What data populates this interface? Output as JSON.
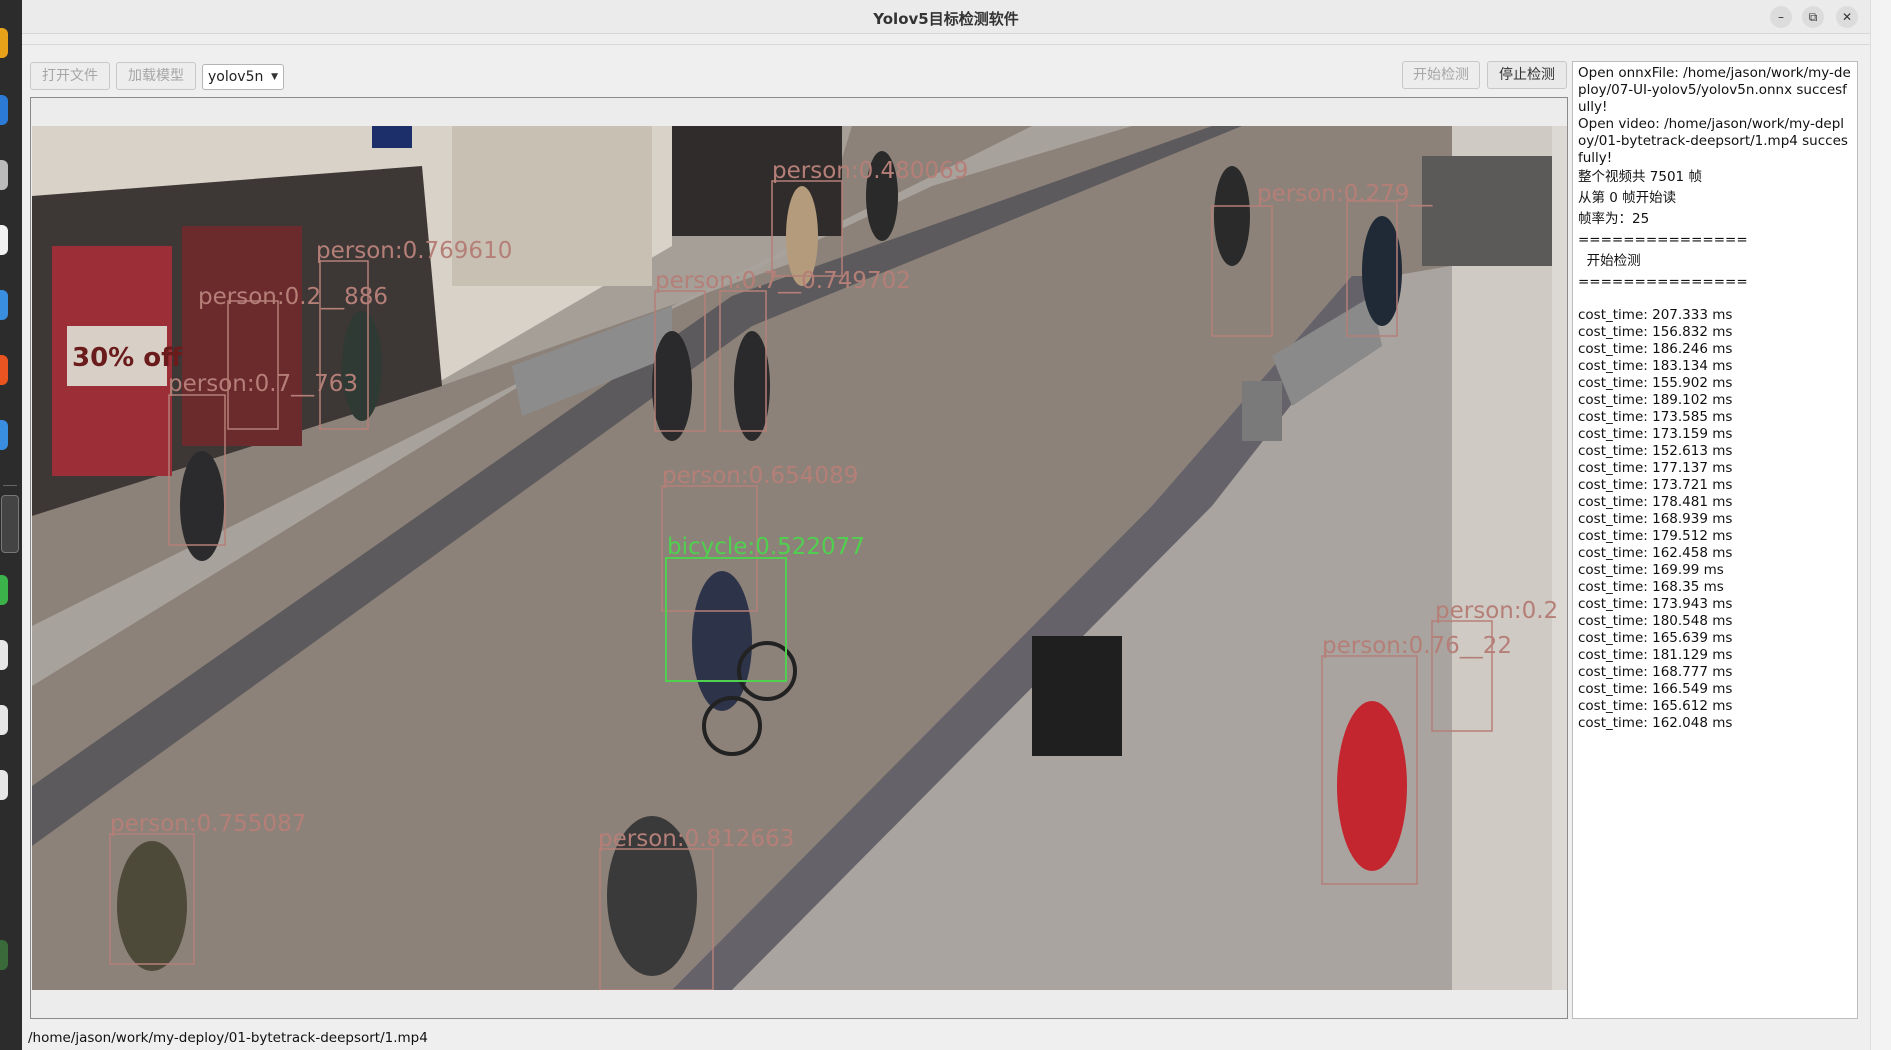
{
  "window": {
    "title": "Yolov5目标检测软件"
  },
  "window_controls": {
    "minimize": "–",
    "maximize": "⧉",
    "close": "✕"
  },
  "toolbar": {
    "open_file": "打开文件",
    "load_model": "加载模型",
    "model_select": "yolov5n",
    "start_detect": "开始检测",
    "stop_detect": "停止检测"
  },
  "detections": [
    {
      "label": "person:0.769610",
      "color": "#b57f78"
    },
    {
      "label": "person:0.2__886",
      "color": "#b57f78"
    },
    {
      "label": "person:0.7__763",
      "color": "#b57f78"
    },
    {
      "label": "person:0.7__0.749702",
      "color": "#b57f78"
    },
    {
      "label": "person:0.480069",
      "color": "#b57f78"
    },
    {
      "label": "person:0.279__",
      "color": "#b57f78"
    },
    {
      "label": "person:0.654089",
      "color": "#b57f78"
    },
    {
      "label": "bicycle:0.522077",
      "color": "#4fd14f"
    },
    {
      "label": "person:0.2",
      "color": "#b57f78"
    },
    {
      "label": "person:0.76__22",
      "color": "#b57f78"
    },
    {
      "label": "person:0.755087",
      "color": "#b57f78"
    },
    {
      "label": "person:0.812663",
      "color": "#b57f78"
    }
  ],
  "log": {
    "lines": [
      "Open onnxFile: /home/jason/work/my-deploy/07-UI-yolov5/yolov5n.onnx succesfully!",
      "Open video: /home/jason/work/my-deploy/01-bytetrack-deepsort/1.mp4 succesfully!",
      "整个视频共 7501 帧",
      "从第 0 帧开始读",
      "帧率为：25",
      "===============",
      "  开始检测",
      "==============="
    ],
    "cost_times": [
      "cost_time: 207.333 ms",
      "cost_time: 156.832 ms",
      "cost_time: 186.246 ms",
      "cost_time: 183.134 ms",
      "cost_time: 155.902 ms",
      "cost_time: 189.102 ms",
      "cost_time: 173.585 ms",
      "cost_time: 173.159 ms",
      "cost_time: 152.613 ms",
      "cost_time: 177.137 ms",
      "cost_time: 173.721 ms",
      "cost_time: 178.481 ms",
      "cost_time: 168.939 ms",
      "cost_time: 179.512 ms",
      "cost_time: 162.458 ms",
      "cost_time: 169.99 ms",
      "cost_time: 168.35 ms",
      "cost_time: 173.943 ms",
      "cost_time: 180.548 ms",
      "cost_time: 165.639 ms",
      "cost_time: 181.129 ms",
      "cost_time: 168.777 ms",
      "cost_time: 166.549 ms",
      "cost_time: 165.612 ms",
      "cost_time: 162.048 ms"
    ]
  },
  "status": {
    "path": "/home/jason/work/my-deploy/01-bytetrack-deepsort/1.mp4"
  },
  "storefront_sign": "30% off"
}
